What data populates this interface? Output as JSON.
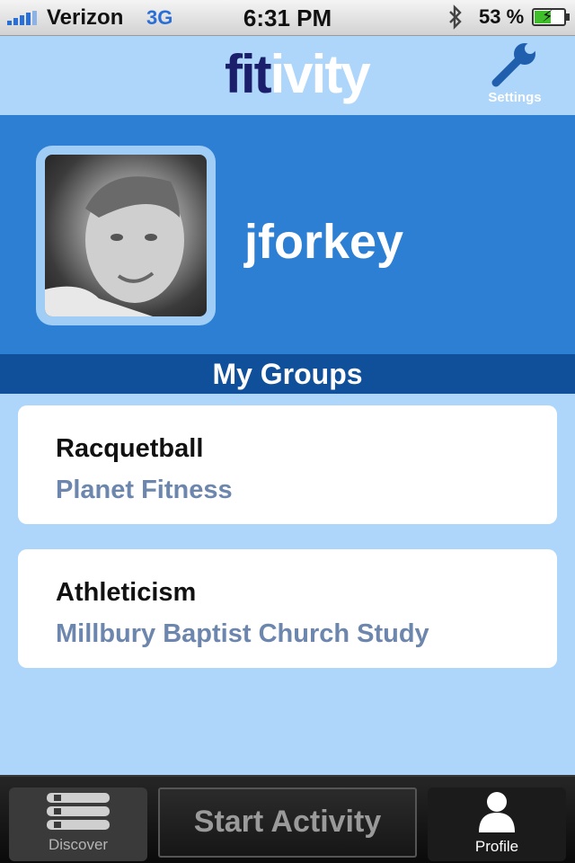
{
  "status_bar": {
    "carrier": "Verizon",
    "network": "3G",
    "time": "6:31 PM",
    "battery_percent": "53 %",
    "battery_level": 0.53,
    "bluetooth_icon": "bluetooth-icon"
  },
  "header": {
    "logo_part1": "fit",
    "logo_part2": "ivity",
    "settings_label": "Settings",
    "settings_icon": "wrench-icon"
  },
  "profile": {
    "username": "jforkey"
  },
  "groups": {
    "section_title": "My Groups",
    "items": [
      {
        "name": "Racquetball",
        "place": "Planet Fitness"
      },
      {
        "name": "Athleticism",
        "place": "Millbury Baptist Church Study"
      }
    ]
  },
  "tab_bar": {
    "discover_label": "Discover",
    "start_label": "Start Activity",
    "profile_label": "Profile"
  },
  "colors": {
    "header_bg": "#aed5fa",
    "profile_band": "#2c7fd3",
    "section_header": "#10509a",
    "logo_dark": "#1b1f6b",
    "group_subtitle": "#6d86ad"
  }
}
